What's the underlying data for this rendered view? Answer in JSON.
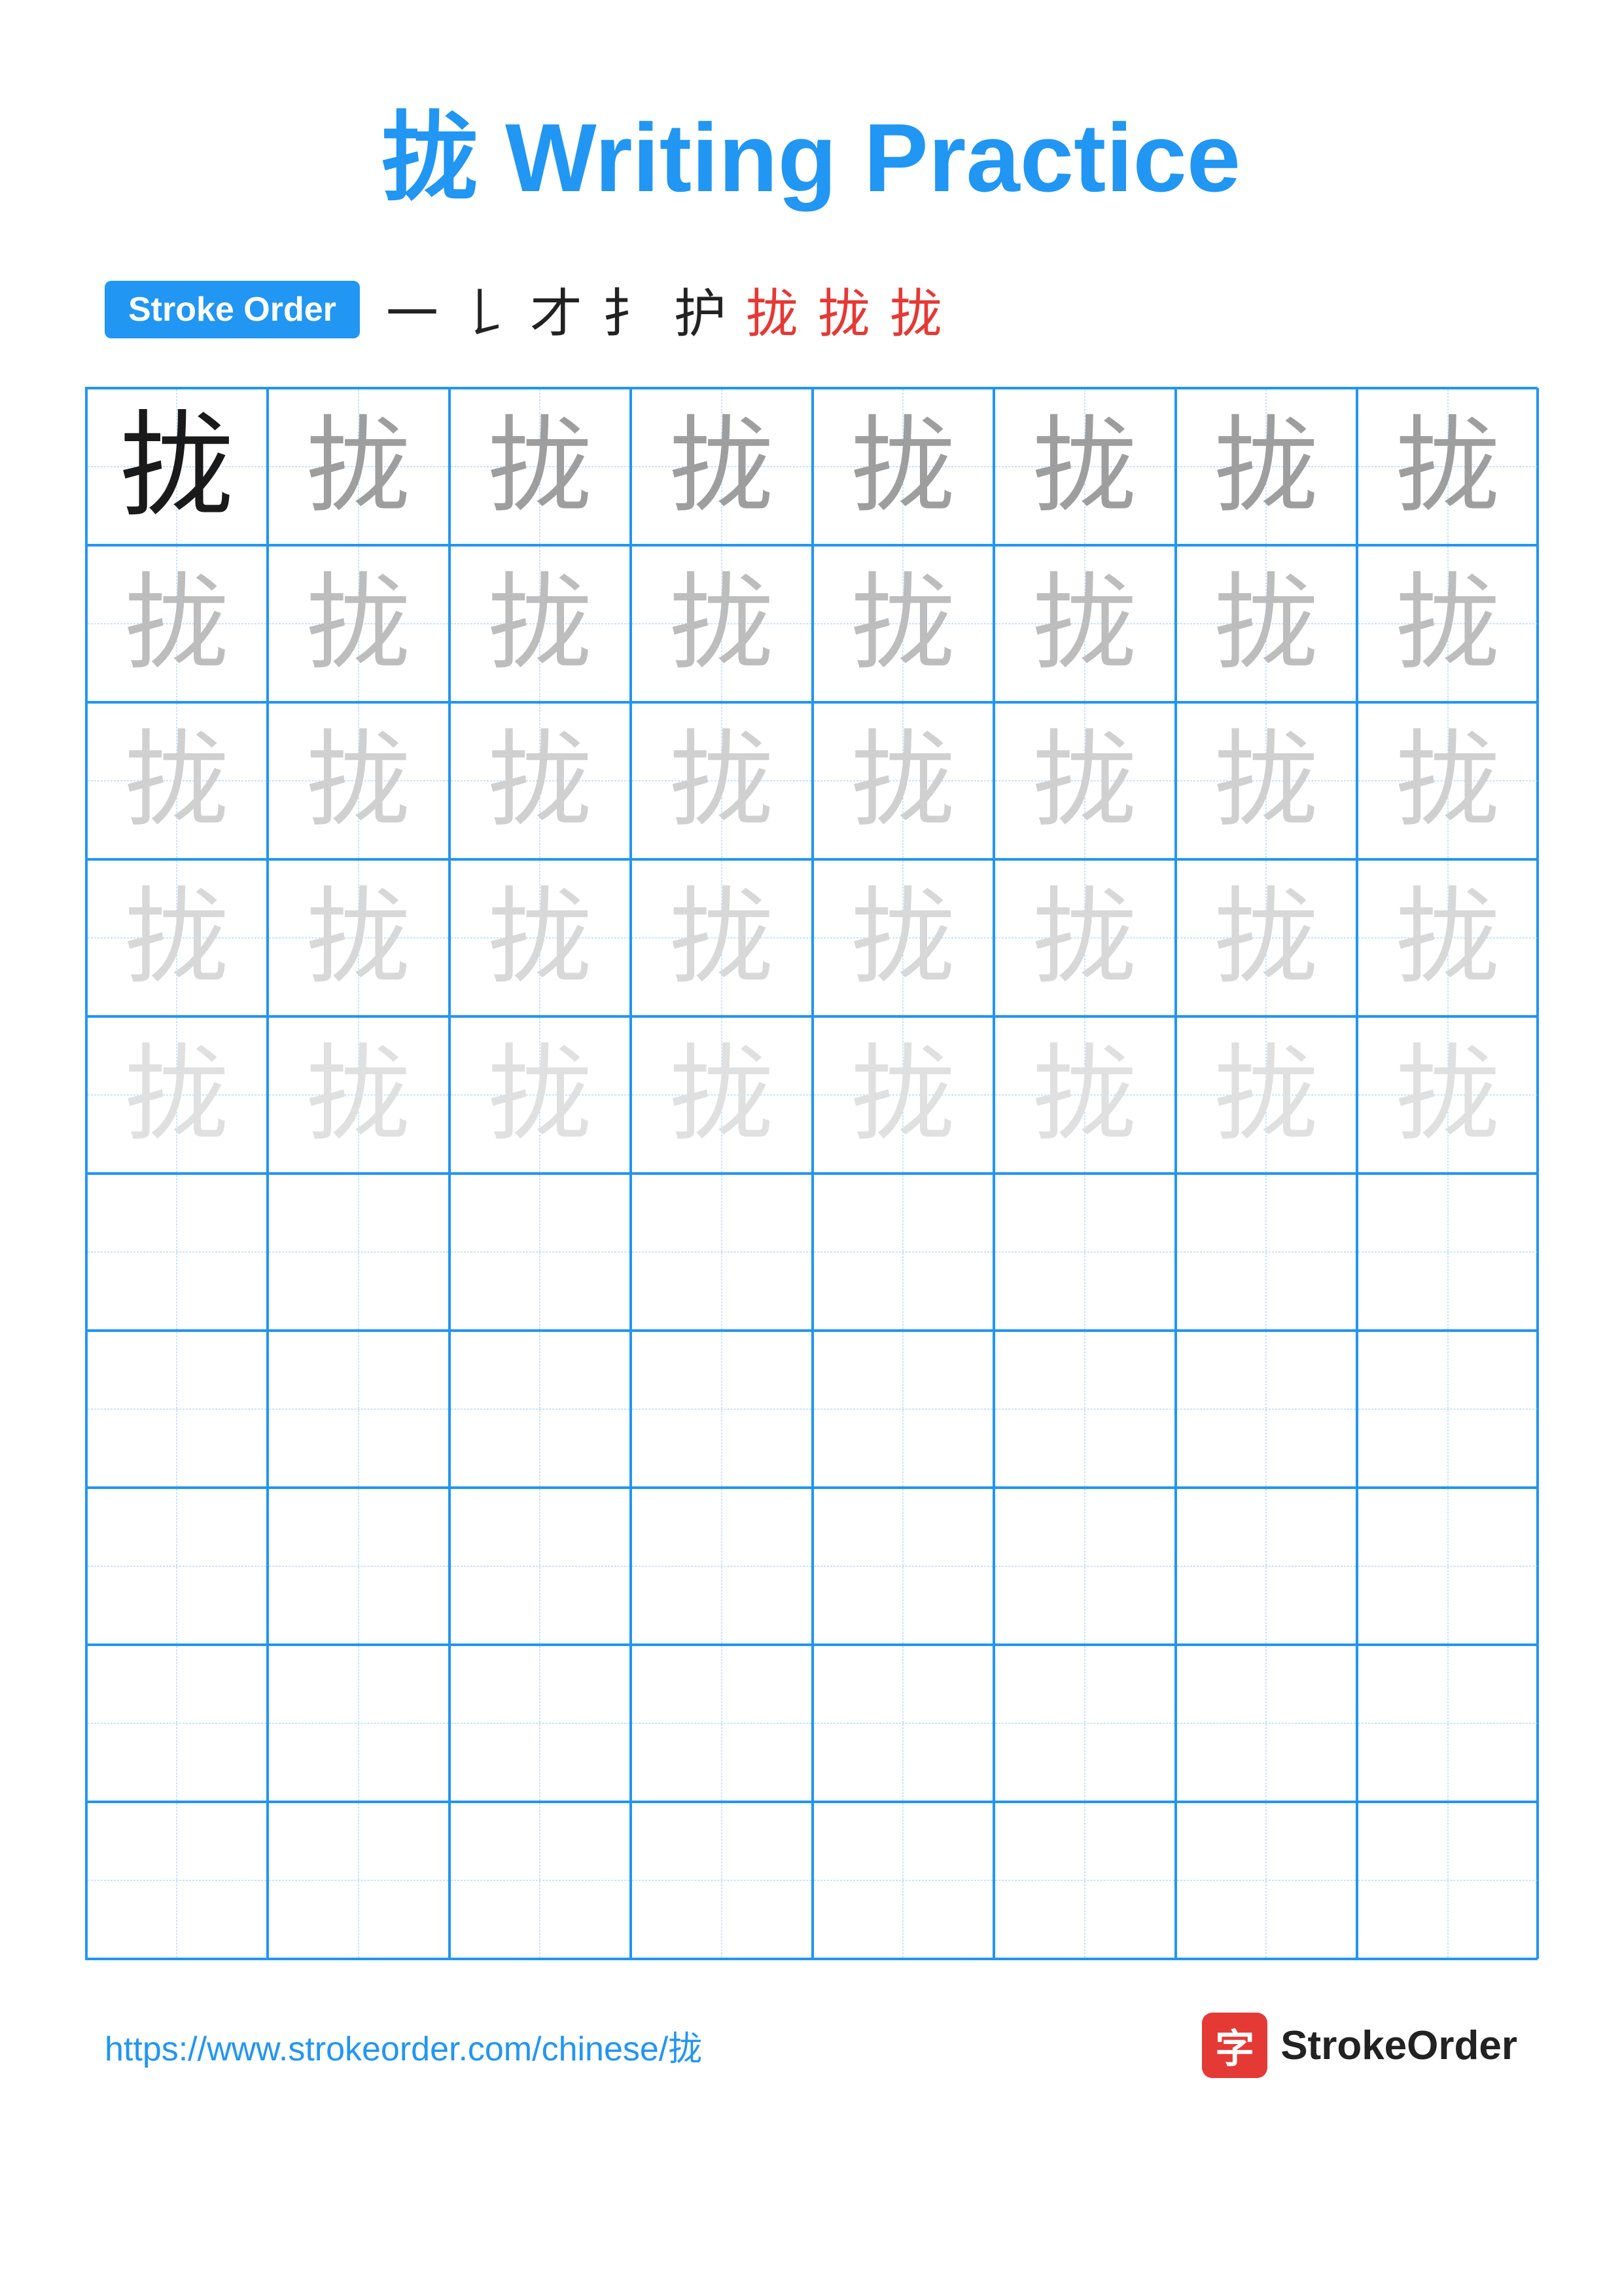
{
  "title": {
    "character": "拢",
    "text": "Writing Practice",
    "full": "拢 Writing Practice"
  },
  "stroke_order": {
    "badge_label": "Stroke Order",
    "steps": [
      "一",
      "𠄌",
      "才",
      "扌",
      "护",
      "拢",
      "拢",
      "拢"
    ]
  },
  "grid": {
    "cols": 8,
    "rows": 10,
    "character": "拢",
    "practice_rows": 5,
    "empty_rows": 5
  },
  "footer": {
    "url": "https://www.strokeorder.com/chinese/拢",
    "brand": "StrokeOrder",
    "logo_char": "字"
  }
}
